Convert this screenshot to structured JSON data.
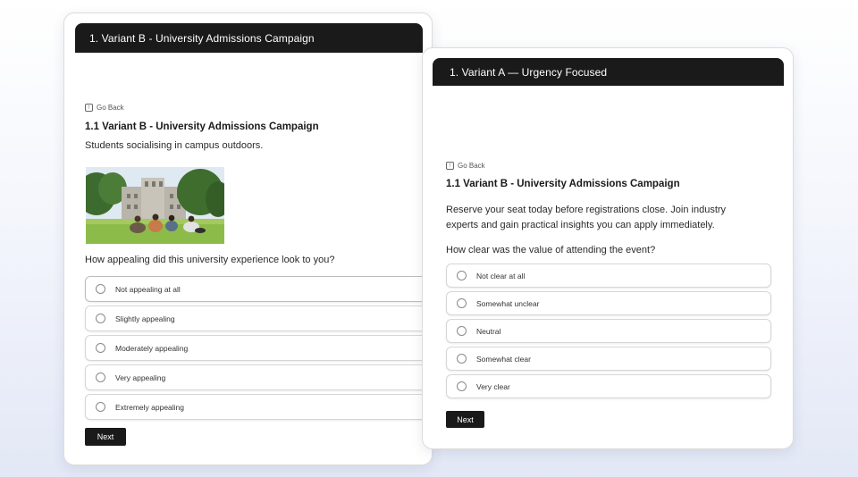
{
  "variant_b": {
    "header": "1. Variant B - University Admissions Campaign",
    "go_back": "Go Back",
    "title": "1.1 Variant B - University Admissions Campaign",
    "description": "Students socialising in campus outdoors.",
    "question": "How appealing did this university experience look to you?",
    "options": [
      "Not appealing at all",
      "Slightly appealing",
      "Moderately appealing",
      "Very appealing",
      "Extremely appealing"
    ],
    "next_label": "Next"
  },
  "variant_a": {
    "header": "1. Variant A — Urgency Focused",
    "go_back": "Go Back",
    "title": "1.1 Variant B - University Admissions Campaign",
    "description": "Reserve your seat today before registrations close. Join industry experts and gain practical insights you can apply immediately.",
    "question": "How clear was the value of attending the event?",
    "options": [
      "Not clear at all",
      "Somewhat unclear",
      "Neutral",
      "Somewhat clear",
      "Very clear"
    ],
    "next_label": "Next"
  },
  "colors": {
    "header_bg": "#1a1a1a",
    "button_bg": "#1a1a1a",
    "card_bg": "#ffffff"
  }
}
